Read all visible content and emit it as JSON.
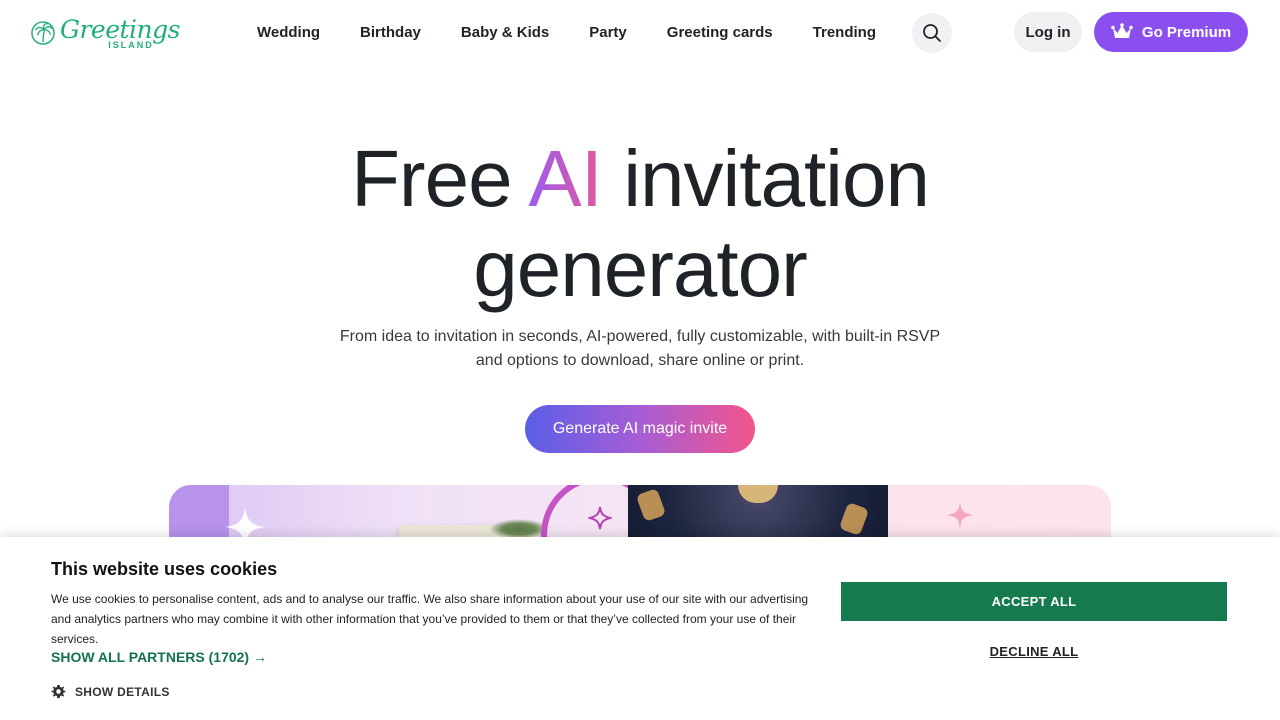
{
  "header": {
    "logo": {
      "name": "Greetings",
      "sub": "ISLAND"
    },
    "nav": [
      {
        "label": "Wedding"
      },
      {
        "label": "Birthday"
      },
      {
        "label": "Baby & Kids"
      },
      {
        "label": "Party"
      },
      {
        "label": "Greeting cards"
      },
      {
        "label": "Trending"
      }
    ],
    "search_icon": "search-icon",
    "login_label": "Log in",
    "premium_label": "Go Premium",
    "premium_color": "#8b4ff0"
  },
  "hero": {
    "title_pre": "Free ",
    "title_ai": "AI",
    "title_post": " invitation",
    "title_line2": "generator",
    "subtitle_line1": "From idea to invitation in seconds, AI-powered, fully customizable, with built-in RSVP",
    "subtitle_line2": "and options to download, share online or print.",
    "cta_label": "Generate AI magic invite"
  },
  "cookie": {
    "title": "This website uses cookies",
    "text": "We use cookies to personalise content, ads and to analyse our traffic. We also share information about your use of our site with our advertising and analytics partners who may combine it with other information that you’ve provided to them or that they’ve collected from your use of their services.",
    "partners_label": "SHOW ALL PARTNERS (1702) →",
    "details_label": "SHOW DETAILS",
    "accept_label": "ACCEPT ALL",
    "decline_label": "DECLINE ALL",
    "accept_color": "#157a4d"
  }
}
